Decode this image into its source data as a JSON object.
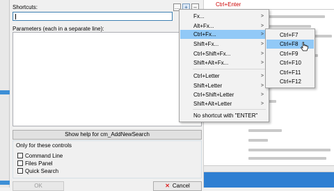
{
  "dialog": {
    "shortcuts_label": "Shortcuts:",
    "params_label": "Parameters (each in a separate line):",
    "help_button": "Show help for cm_AddNewSearch",
    "group_label": "Only for these controls",
    "checkboxes": [
      "Command Line",
      "Files Panel",
      "Quick Search"
    ],
    "ok_button": "OK",
    "cancel_button": "Cancel",
    "toolbar_buttons": [
      "…",
      "+",
      "–"
    ]
  },
  "background": {
    "red_text": "Ctrl+Enter"
  },
  "main_menu": {
    "items": [
      "Fx...",
      "Alt+Fx...",
      "Ctrl+Fx...",
      "Shift+Fx...",
      "Ctrl+Shift+Fx...",
      "Shift+Alt+Fx...",
      "Ctrl+Letter",
      "Shift+Letter",
      "Ctrl+Shift+Letter",
      "Shift+Alt+Letter",
      "No shortcut with \"ENTER\""
    ],
    "highlighted": "Ctrl+Fx..."
  },
  "sub_menu": {
    "items": [
      "Ctrl+F7",
      "Ctrl+F8",
      "Ctrl+F9",
      "Ctrl+F10",
      "Ctrl+F11",
      "Ctrl+F12"
    ],
    "highlighted": "Ctrl+F8"
  },
  "colors": {
    "highlight": "#91c9f7",
    "accent_blue": "#2e7fd2"
  }
}
